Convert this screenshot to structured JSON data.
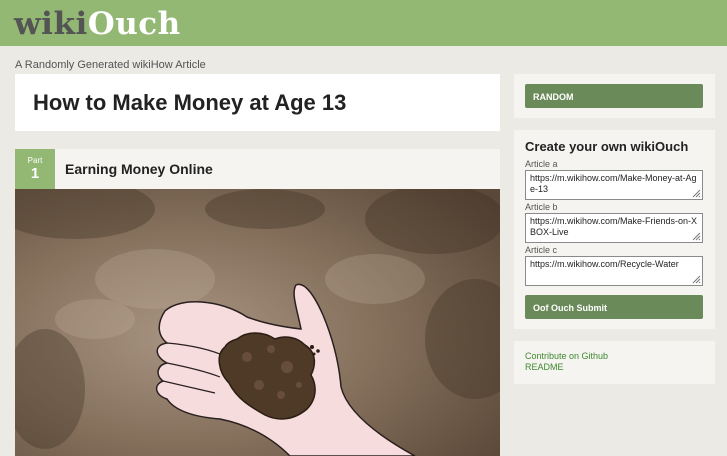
{
  "header": {
    "logo_wiki": "wiki",
    "logo_ouch": "Ouch",
    "subtitle": "A Randomly Generated wikiHow Article"
  },
  "article": {
    "title": "How to Make Money at Age 13",
    "part_label": "Part",
    "part_number": "1",
    "part_title": "Earning Money Online",
    "image_icon": "hand-holding-dirt-illustration"
  },
  "sidebar": {
    "random_label": "RANDOM",
    "form_title": "Create your own wikiOuch",
    "fields": [
      {
        "label": "Article a",
        "value": "https://m.wikihow.com/Make-Money-at-Age-13"
      },
      {
        "label": "Article b",
        "value": "https://m.wikihow.com/Make-Friends-on-XBOX-Live"
      },
      {
        "label": "Article c",
        "value": "https://m.wikihow.com/Recycle-Water"
      }
    ],
    "submit_label": "Oof Ouch Submit",
    "links": [
      "Contribute on Github",
      "README"
    ]
  },
  "colors": {
    "brand_green": "#93b874",
    "button_green": "#6b8a59",
    "link_green": "#3f8a2e"
  }
}
